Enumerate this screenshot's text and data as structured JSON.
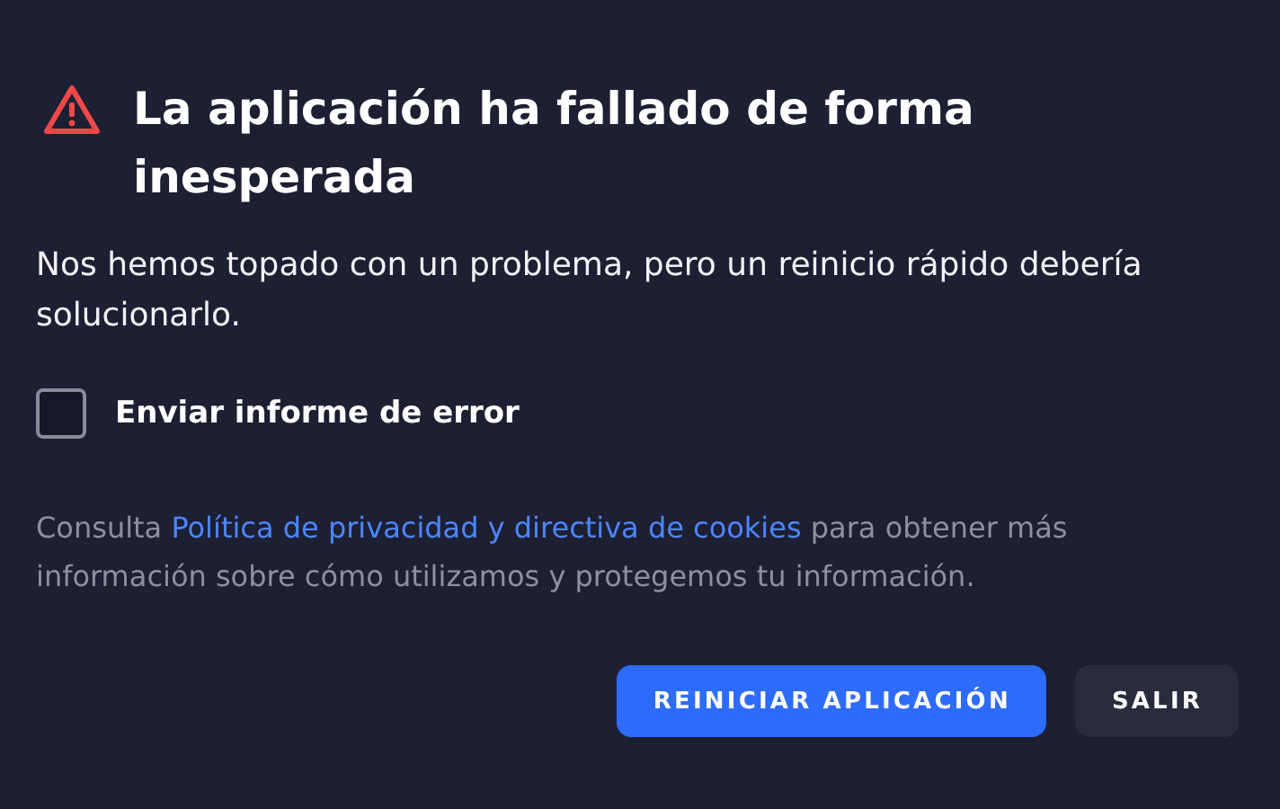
{
  "dialog": {
    "title": "La aplicación ha fallado de forma inesperada",
    "message": "Nos hemos topado con un problema, pero un reinicio rápido debería solucionarlo.",
    "checkbox": {
      "label": "Enviar informe de error",
      "checked": false
    },
    "privacy": {
      "prefix": "Consulta ",
      "link": "Política de privacidad y directiva de cookies",
      "suffix": " para obtener más información sobre cómo utilizamos y protegemos tu información."
    },
    "buttons": [
      {
        "label": "REINICIAR APLICACIÓN",
        "kind": "primary"
      },
      {
        "label": "SALIR",
        "kind": "secondary"
      }
    ]
  }
}
